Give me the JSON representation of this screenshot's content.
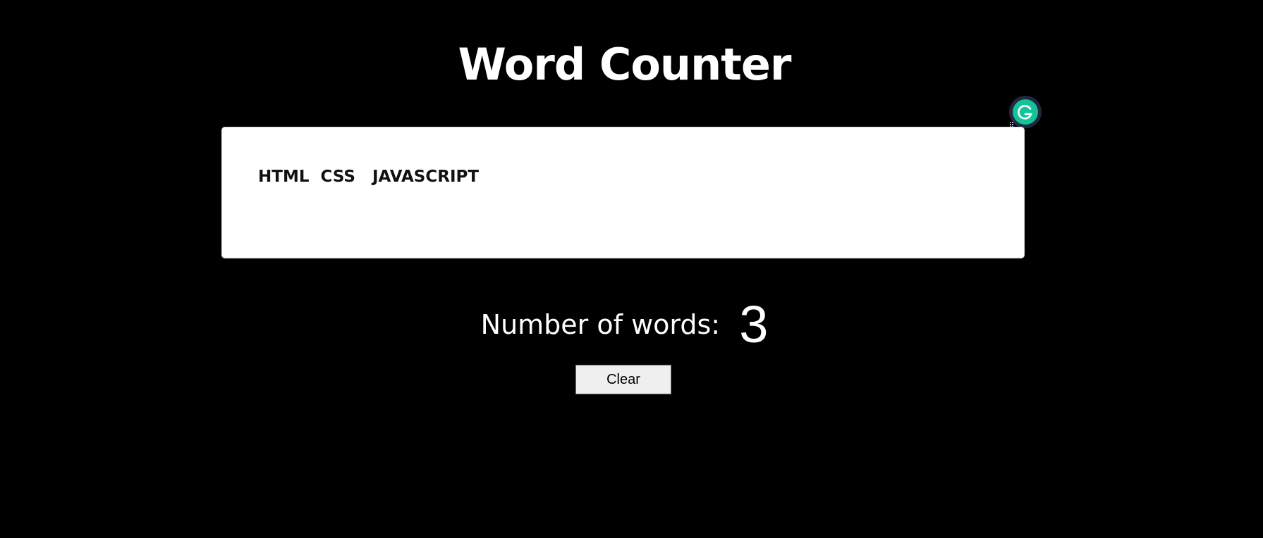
{
  "page": {
    "title": "Word Counter"
  },
  "editor": {
    "value": "HTML  CSS   JAVASCRIPT"
  },
  "counter": {
    "label": "Number of words:",
    "value": "3"
  },
  "actions": {
    "clear_label": "Clear"
  },
  "icons": {
    "grammarly": "grammarly-icon",
    "resize": "resize-grip-icon"
  },
  "colors": {
    "background": "#000000",
    "text": "#ffffff",
    "grammarly_green": "#15c39a",
    "grammarly_ring": "#1f2940"
  }
}
